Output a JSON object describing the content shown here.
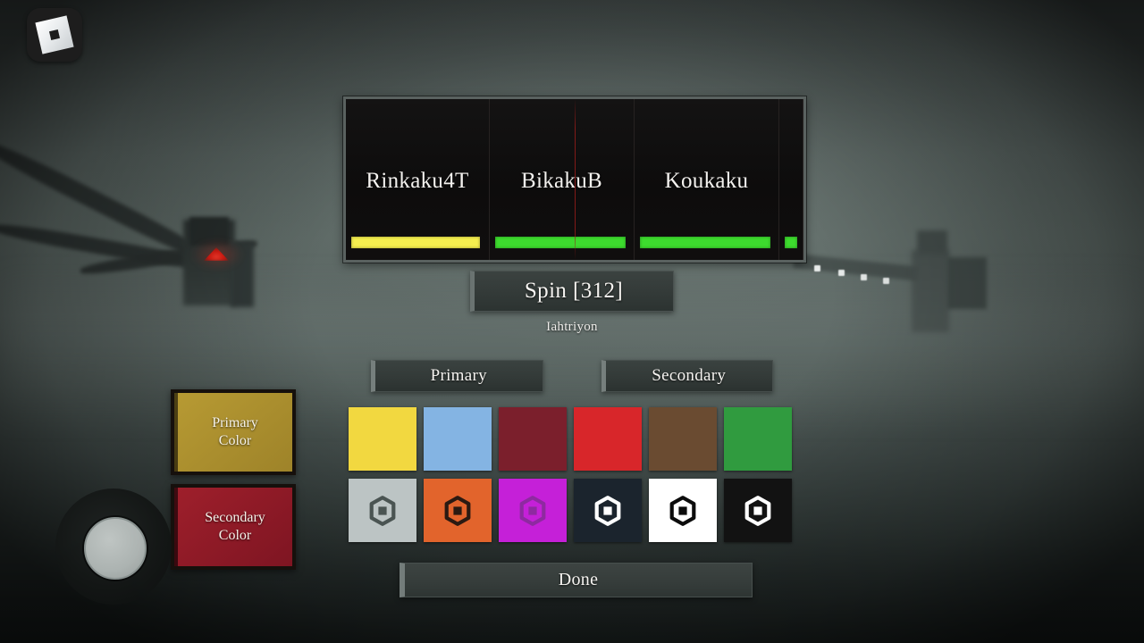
{
  "colors": {
    "kagune_bar_yellow": "#f5ee4f",
    "kagune_bar_green": "#3ddb2e",
    "panel_border": "#5a6260",
    "panel_bg": "#0d0c0c",
    "primary_color": "#b79a33",
    "secondary_color": "#9e1f2b",
    "accent_line": "#6a7371"
  },
  "corner_logo": {
    "name": "roblox-logo",
    "icon": "roblox-tile-icon"
  },
  "joystick": {
    "name": "movement-joystick",
    "knob": "joystick-knob"
  },
  "kagune_panel": {
    "items": [
      {
        "label": "Rinkaku4T",
        "bar_percent": 97,
        "bar_color": "#f5ee4f"
      },
      {
        "label": "BikakuB",
        "bar_percent": 98,
        "bar_color": "#3ddb2e"
      },
      {
        "label": "Koukaku",
        "bar_percent": 98,
        "bar_color": "#3ddb2e"
      },
      {
        "label": "",
        "bar_percent": 100,
        "bar_color": "#3ddb2e"
      }
    ]
  },
  "spin": {
    "label": "Spin [312]",
    "count": 312,
    "username": "Iahtriyon"
  },
  "tabs": [
    {
      "label": "Primary",
      "selected": true
    },
    {
      "label": "Secondary",
      "selected": false
    }
  ],
  "side_buttons": [
    {
      "label_line1": "Primary",
      "label_line2": "Color",
      "swatch": "#b79a33"
    },
    {
      "label_line1": "Secondary",
      "label_line2": "Color",
      "swatch": "#9e1f2b"
    }
  ],
  "palette": {
    "row1": [
      {
        "name": "swatch-yellow",
        "hex": "#f2d840",
        "icon": null
      },
      {
        "name": "swatch-light-blue",
        "hex": "#84b4e3",
        "icon": null
      },
      {
        "name": "swatch-dark-maroon",
        "hex": "#7b1f2c",
        "icon": null
      },
      {
        "name": "swatch-red",
        "hex": "#d8262a",
        "icon": null
      },
      {
        "name": "swatch-brown",
        "hex": "#6a4b31",
        "icon": null
      },
      {
        "name": "swatch-green",
        "hex": "#309b3f",
        "icon": null
      }
    ],
    "row2": [
      {
        "name": "swatch-light-gray",
        "hex": "#bcc4c4",
        "icon": "roblox-icon",
        "icon_color": "#4a5452"
      },
      {
        "name": "swatch-orange",
        "hex": "#e2642c",
        "icon": "roblox-icon",
        "icon_color": "#2b1a12"
      },
      {
        "name": "swatch-magenta",
        "hex": "#c520d8",
        "icon": "roblox-icon",
        "icon_color": "#8e2aa0"
      },
      {
        "name": "swatch-dark-navy",
        "hex": "#1b242d",
        "icon": "roblox-icon",
        "icon_color": "#ffffff"
      },
      {
        "name": "swatch-white",
        "hex": "#ffffff",
        "icon": "roblox-icon",
        "icon_color": "#0c0c0c"
      },
      {
        "name": "swatch-black",
        "hex": "#121212",
        "icon": "roblox-icon",
        "icon_color": "#ffffff"
      }
    ]
  },
  "done": {
    "label": "Done"
  }
}
